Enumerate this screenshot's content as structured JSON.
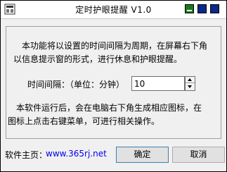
{
  "window": {
    "title": "定时护眼提醒 V1.0",
    "app_icon": "eye-app-icon",
    "controls": {
      "minimize_icon": "minimize-icon",
      "maximize_icon": "maximize-icon",
      "close_icon": "close-icon"
    }
  },
  "main": {
    "intro_line1": "　本功能将以设置的时间间隔为周期，在屏幕右下角",
    "intro_line2": "以信息提示窗的形式，进行休息和护眼提醒。",
    "interval_label": "时间间隔：（单位：分钟）",
    "interval_value": "10",
    "info_line1": "　本软件运行后，会在电脑右下角生成相应图标，在",
    "info_line2": "图标上点击右键菜单，可进行相关操作。"
  },
  "footer": {
    "homepage_label": "软件主页：",
    "homepage_link": "www.365rj.net",
    "ok_label": "确定",
    "cancel_label": "取消"
  },
  "colors": {
    "minimize": "#1a7a1a",
    "maximize": "#0a2a8a",
    "close": "#0a2a8a",
    "link": "#0000ee"
  }
}
